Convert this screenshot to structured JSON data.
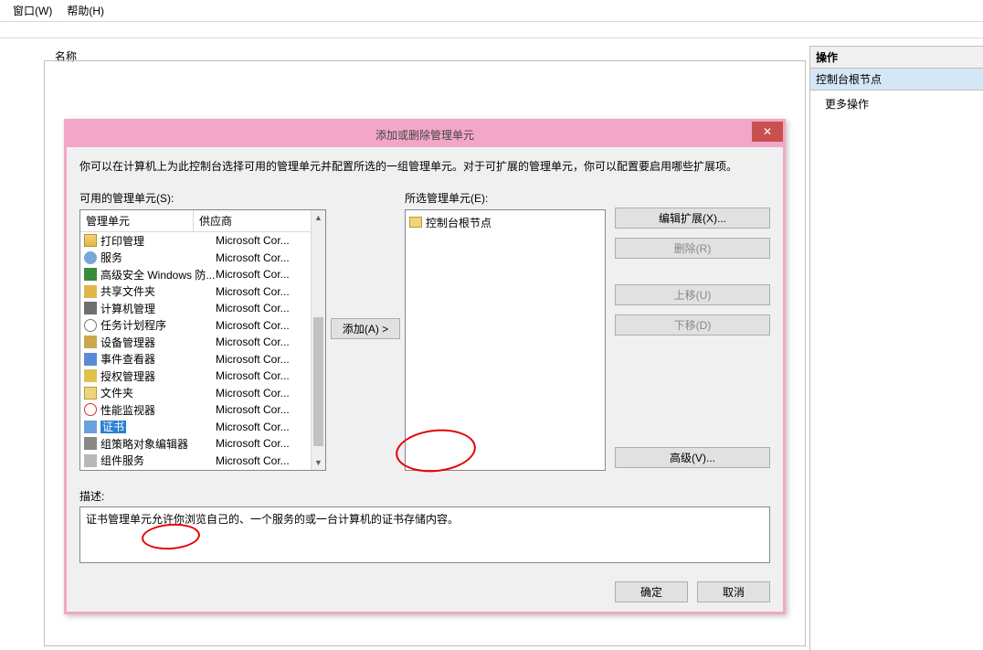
{
  "menu": {
    "window": "窗口(W)",
    "help": "帮助(H)"
  },
  "leftPane": {
    "nameHeader": "名称"
  },
  "rightPane": {
    "header": "操作",
    "rootNode": "控制台根节点",
    "more": "更多操作"
  },
  "dialog": {
    "title": "添加或删除管理单元",
    "description": "你可以在计算机上为此控制台选择可用的管理单元并配置所选的一组管理单元。对于可扩展的管理单元，你可以配置要启用哪些扩展项。",
    "availableLabel": "可用的管理单元(S):",
    "selectedLabel": "所选管理单元(E):",
    "addBtn": "添加(A) >",
    "editExtBtn": "编辑扩展(X)...",
    "removeBtn": "删除(R)",
    "upBtn": "上移(U)",
    "downBtn": "下移(D)",
    "advBtn": "高级(V)...",
    "descLabel": "描述:",
    "descText": "证书管理单元允许你浏览自己的、一个服务的或一台计算机的证书存储内容。",
    "ok": "确定",
    "cancel": "取消",
    "listHeaders": {
      "name": "管理单元",
      "vendor": "供应商"
    },
    "selectedRoot": "控制台根节点",
    "items": [
      {
        "name": "打印管理",
        "vendor": "Microsoft Cor...",
        "ic": "ic-print"
      },
      {
        "name": "服务",
        "vendor": "Microsoft Cor...",
        "ic": "ic-gear"
      },
      {
        "name": "高级安全 Windows 防...",
        "vendor": "Microsoft Cor...",
        "ic": "ic-shield"
      },
      {
        "name": "共享文件夹",
        "vendor": "Microsoft Cor...",
        "ic": "ic-share"
      },
      {
        "name": "计算机管理",
        "vendor": "Microsoft Cor...",
        "ic": "ic-pc"
      },
      {
        "name": "任务计划程序",
        "vendor": "Microsoft Cor...",
        "ic": "ic-clock"
      },
      {
        "name": "设备管理器",
        "vendor": "Microsoft Cor...",
        "ic": "ic-dev"
      },
      {
        "name": "事件查看器",
        "vendor": "Microsoft Cor...",
        "ic": "ic-event"
      },
      {
        "name": "授权管理器",
        "vendor": "Microsoft Cor...",
        "ic": "ic-auth"
      },
      {
        "name": "文件夹",
        "vendor": "Microsoft Cor...",
        "ic": "ic-folder"
      },
      {
        "name": "性能监视器",
        "vendor": "Microsoft Cor...",
        "ic": "ic-perf"
      },
      {
        "name": "证书",
        "vendor": "Microsoft Cor...",
        "ic": "ic-cert",
        "selected": true
      },
      {
        "name": "组策略对象编辑器",
        "vendor": "Microsoft Cor...",
        "ic": "ic-grp"
      },
      {
        "name": "组件服务",
        "vendor": "Microsoft Cor...",
        "ic": "ic-comp"
      }
    ]
  }
}
